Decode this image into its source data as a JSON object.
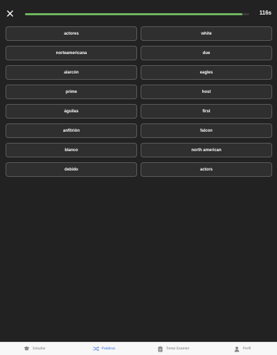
{
  "header": {
    "timer": "116s",
    "progress": 0.97,
    "progress_color": "#6fb860",
    "close_icon": "close-icon"
  },
  "left_words": [
    "actores",
    "norteamericana",
    "alarcón",
    "prime",
    "águilas",
    "anfitrión",
    "blanco",
    "debido"
  ],
  "right_words": [
    "white",
    "due",
    "eagles",
    "host",
    "first",
    "falcon",
    "north american",
    "actors"
  ],
  "nav": {
    "items": [
      {
        "label": "Estudiar",
        "icon": "graduation-cap-icon",
        "active": false
      },
      {
        "label": "Palabras",
        "icon": "shuffle-icon",
        "active": true
      },
      {
        "label": "Tomar Examen",
        "icon": "clipboard-icon",
        "active": false
      },
      {
        "label": "Perfil",
        "icon": "person-icon",
        "active": false
      }
    ],
    "active_color": "#4a7de0"
  }
}
